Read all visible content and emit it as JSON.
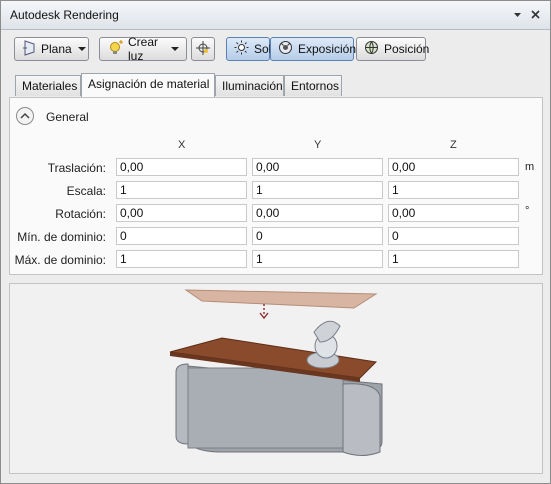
{
  "window": {
    "title": "Autodesk Rendering"
  },
  "toolbar": {
    "plana_label": "Plana",
    "crear_luz_label": "Crear luz",
    "sol_label": "Sol",
    "exposicion_label": "Exposición",
    "posicion_label": "Posición"
  },
  "tabs": [
    {
      "label": "Materiales"
    },
    {
      "label": "Asignación de material"
    },
    {
      "label": "Iluminación"
    },
    {
      "label": "Entornos"
    }
  ],
  "general": {
    "title": "General",
    "columns": [
      "X",
      "Y",
      "Z"
    ],
    "rows": [
      {
        "label": "Traslación:",
        "values": [
          "0,00",
          "0,00",
          "0,00"
        ],
        "unit": "m"
      },
      {
        "label": "Escala:",
        "values": [
          "1",
          "1",
          "1"
        ],
        "unit": ""
      },
      {
        "label": "Rotación:",
        "values": [
          "0,00",
          "0,00",
          "0,00"
        ],
        "unit": "°"
      },
      {
        "label": "Mín. de dominio:",
        "values": [
          "0",
          "0",
          "0"
        ],
        "unit": ""
      },
      {
        "label": "Máx. de dominio:",
        "values": [
          "1",
          "1",
          "1"
        ],
        "unit": ""
      }
    ]
  },
  "colors": {
    "accent_active": "#b6cde9",
    "table_wood": "#8a4a2c",
    "plane": "#d8b5a2"
  }
}
